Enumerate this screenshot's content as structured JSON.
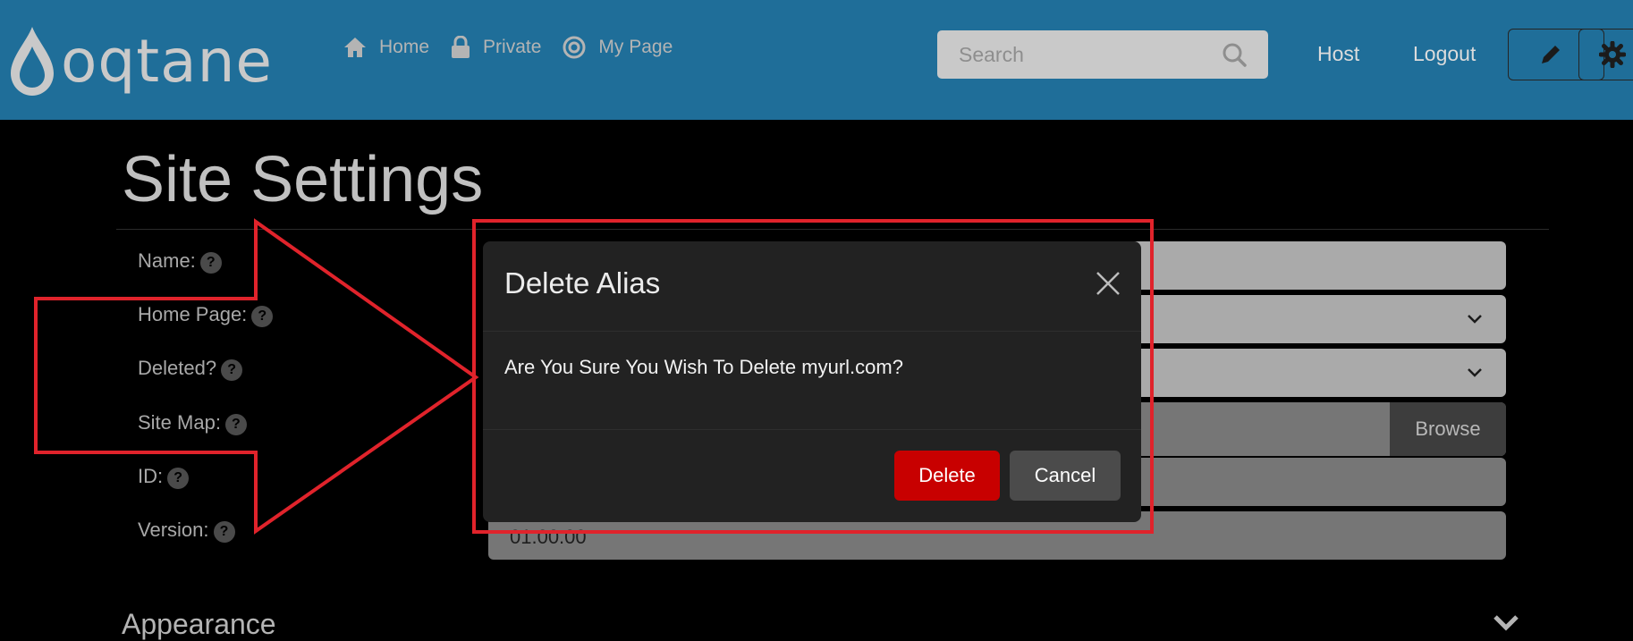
{
  "navbar": {
    "logo_text": "oqtane",
    "links": [
      {
        "label": "Home",
        "icon": "home-icon"
      },
      {
        "label": "Private",
        "icon": "lock-icon"
      },
      {
        "label": "My Page",
        "icon": "target-icon"
      }
    ],
    "search": {
      "placeholder": "Search"
    },
    "host_label": "Host",
    "logout_label": "Logout"
  },
  "page": {
    "title": "Site Settings",
    "fields": [
      {
        "label": "Name:"
      },
      {
        "label": "Home Page:"
      },
      {
        "label": "Deleted?"
      },
      {
        "label": "Site Map:"
      },
      {
        "label": "ID:"
      },
      {
        "label": "Version:",
        "value": "01.00.00"
      }
    ],
    "help_glyph": "?",
    "browse_label": "Browse",
    "section_appearance": "Appearance"
  },
  "modal": {
    "title": "Delete Alias",
    "message": "Are You Sure You Wish To Delete myurl.com?",
    "delete_label": "Delete",
    "cancel_label": "Cancel"
  },
  "colors": {
    "navbar": "#1f6e99",
    "delete_button": "#c80000",
    "annotation": "#e0232b"
  }
}
